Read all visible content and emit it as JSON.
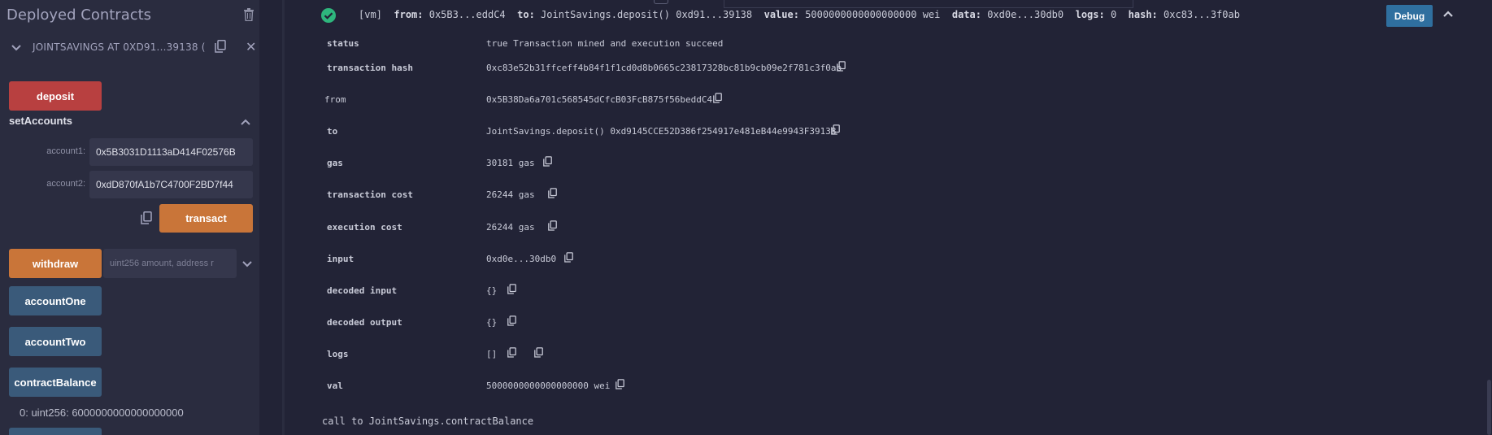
{
  "left": {
    "title": "Deployed Contracts",
    "instance_name": "JOINTSAVINGS AT 0XD91...39138 (",
    "deposit_label": "deposit",
    "setAccounts": {
      "title": "setAccounts",
      "account1_label": "account1:",
      "account1_value": "0x5B3031D1113aD414F02576B",
      "account2_label": "account2:",
      "account2_value": "0xdD870fA1b7C4700F2BD7f44",
      "transact_label": "transact"
    },
    "withdraw_label": "withdraw",
    "withdraw_placeholder": "uint256 amount, address r",
    "accountOne_label": "accountOne",
    "accountTwo_label": "accountTwo",
    "contractBalance_label": "contractBalance",
    "result": "0: uint256: 6000000000000000000"
  },
  "log": {
    "tag": "[vm]",
    "from_key": "from:",
    "from_val": "0x5B3...eddC4",
    "to_key": "to:",
    "to_val": "JointSavings.deposit() 0xd91...39138",
    "value_key": "value:",
    "value_val": "5000000000000000000 wei",
    "data_key": "data:",
    "data_val": "0xd0e...30db0",
    "logs_key": "logs:",
    "logs_val": "0",
    "hash_key": "hash:",
    "hash_val": "0xc83...3f0ab",
    "debug_label": "Debug",
    "rows": [
      {
        "key": "status",
        "value": "true Transaction mined and execution succeed"
      },
      {
        "key": "transaction hash",
        "value": "0xc83e52b31ffceff4b84f1f1cd0d8b0665c23817328bc81b9cb09e2f781c3f0ab"
      },
      {
        "key": "from",
        "value": "0x5B38Da6a701c568545dCfcB03FcB875f56beddC4"
      },
      {
        "key": "to",
        "value": "JointSavings.deposit() 0xd9145CCE52D386f254917e481eB44e9943F39138"
      },
      {
        "key": "gas",
        "value": "30181 gas"
      },
      {
        "key": "transaction cost",
        "value": "26244 gas"
      },
      {
        "key": "execution cost",
        "value": "26244 gas"
      },
      {
        "key": "input",
        "value": "0xd0e...30db0"
      },
      {
        "key": "decoded input",
        "value": "{}"
      },
      {
        "key": "decoded output",
        "value": "{}"
      },
      {
        "key": "logs",
        "value": "[]"
      },
      {
        "key": "val",
        "value": "5000000000000000000 wei"
      }
    ],
    "call_line": "call to JointSavings.contractBalance"
  },
  "colors": {
    "deposit": "#b84040",
    "transact": "#c97539",
    "call_buttons": "#3a5a7a",
    "success": "#2eb67d",
    "debug": "#2f6f9f"
  },
  "icons": [
    "trash-icon",
    "chevron-down-icon",
    "copy-icon",
    "close-icon",
    "check-circle-icon",
    "chevron-up-icon"
  ]
}
